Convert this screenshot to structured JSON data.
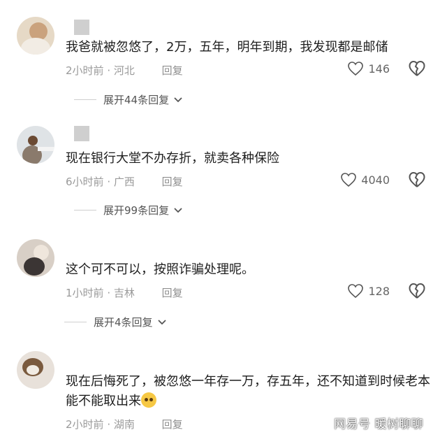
{
  "comments": [
    {
      "text": "我爸就被忽悠了，2万，五年，明年到期，我发现都是邮储",
      "time": "2小时前",
      "location": "河北",
      "reply_label": "回复",
      "likes": "146",
      "expand_label": "展开44条回复"
    },
    {
      "text": "现在银行大堂不办存折，就卖各种保险",
      "time": "6小时前",
      "location": "广西",
      "reply_label": "回复",
      "likes": "4040",
      "expand_label": "展开99条回复"
    },
    {
      "text": "这个可不可以，按照诈骗处理呢。",
      "time": "1小时前",
      "location": "吉林",
      "reply_label": "回复",
      "likes": "128",
      "expand_label": "展开4条回复"
    },
    {
      "text": "现在后悔死了，被忽悠一年存一万，存五年，还不知道到时候老本能不能取出来",
      "time": "2小时前",
      "location": "湖南",
      "reply_label": "回复",
      "likes": ""
    }
  ],
  "separator": " · ",
  "watermark": "网易号 暖树聊聊",
  "colors": {
    "meta_text": "#9a9a9a",
    "icon_stroke": "#555555"
  }
}
